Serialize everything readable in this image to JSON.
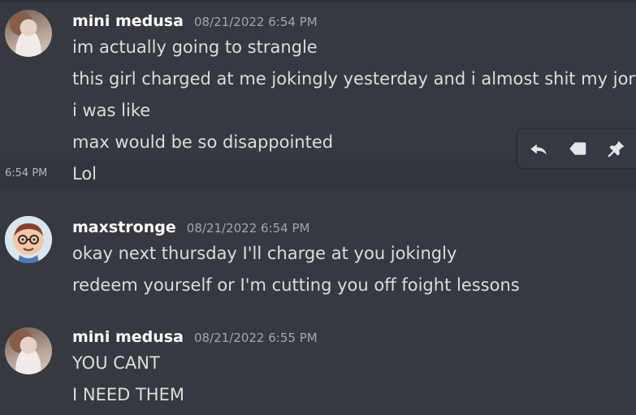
{
  "messages": [
    {
      "author": "mini medusa",
      "time": "08/21/2022 6:54 PM",
      "lines": [
        "im actually going to strangle",
        "this girl charged at me jokingly yesterday and i almost shit my jorts",
        "i was like",
        "max would be so disappointed"
      ]
    },
    {
      "continuation_time": "6:54 PM",
      "text": "Lol"
    },
    {
      "author": "maxstronge",
      "time": "08/21/2022 6:54 PM",
      "lines": [
        "okay next thursday I'll charge at you jokingly",
        "redeem yourself or I'm cutting you off foight lessons"
      ]
    },
    {
      "author": "mini medusa",
      "time": "08/21/2022 6:55 PM",
      "lines": [
        "YOU CANT",
        "I NEED THEM"
      ]
    }
  ],
  "toolbar": {
    "icons": [
      "reply-icon",
      "tag-icon",
      "pin-icon"
    ],
    "color": "#e3e5e8"
  }
}
